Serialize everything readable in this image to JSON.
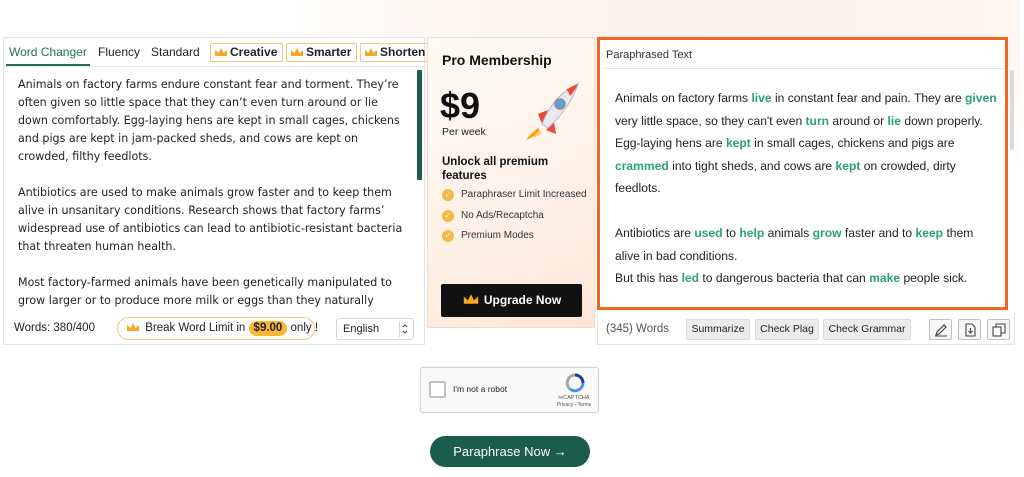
{
  "tabs": {
    "word_changer": "Word Changer",
    "fluency": "Fluency",
    "standard": "Standard",
    "creative": "Creative",
    "smarter": "Smarter",
    "shorten": "Shorten"
  },
  "input": {
    "paragraphs": [
      "Animals on factory farms endure constant fear and torment. They’re often given so little space that they can’t even turn around or lie down comfortably. Egg-laying hens are kept in small cages, chickens and pigs are kept in jam-packed sheds, and cows are kept on crowded, filthy feedlots.",
      "Antibiotics are used to make animals grow faster and to keep them alive in unsanitary conditions. Research shows that factory farms’ widespread use of antibiotics can lead to antibiotic-resistant bacteria that threaten human health.",
      "Most factory-farmed animals have been genetically manipulated to grow larger or to produce more milk or eggs than they naturally would. Some chickens grow so unnaturally large that their legs cannot support their outsized bodies, and they suffer from starvation or dehydration when they"
    ],
    "word_count": "Words: 380/400",
    "break_limit_prefix": "Break Word Limit in",
    "break_limit_price": "$9.00",
    "break_limit_suffix": "only !",
    "language": "English"
  },
  "promo": {
    "title": "Pro Membership",
    "price": "$9",
    "period": "Per week",
    "unlock": "Unlock all premium features",
    "features": [
      "Paraphraser Limit Increased",
      "No Ads/Recaptcha",
      "Premium Modes"
    ],
    "upgrade_label": "Upgrade Now"
  },
  "output": {
    "header": "Paraphrased Text",
    "word_count": "(345) Words",
    "summarize": "Summarize",
    "check_plag": "Check Plag",
    "check_grammar": "Check Grammar"
  },
  "captcha": {
    "label": "I'm not a robot",
    "brand": "reCAPTCHA",
    "terms": "Privacy - Terms"
  },
  "paraphrase_button": "Paraphrase Now →",
  "colors": {
    "accent_green": "#1f6f5c",
    "highlight_green": "#2aa07a",
    "orange_border": "#f26522",
    "premium_gold": "#f7b733"
  }
}
